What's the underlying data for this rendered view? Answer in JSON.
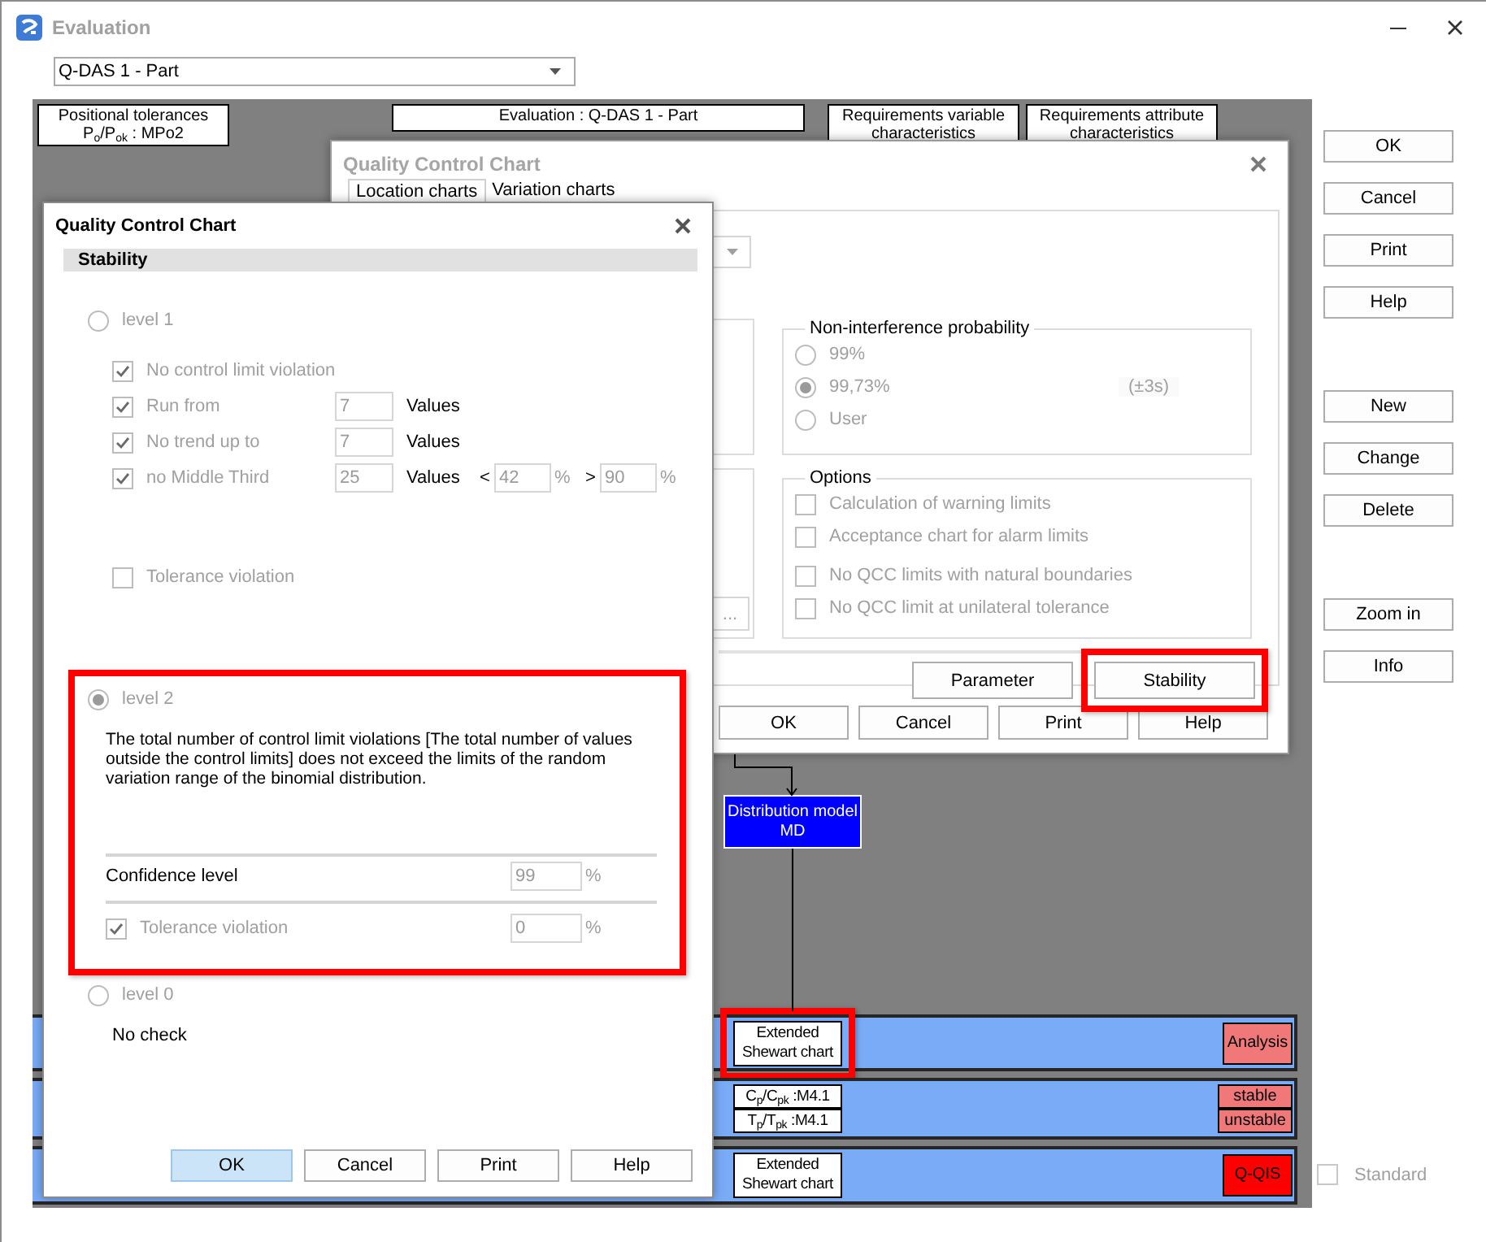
{
  "window": {
    "title": "Evaluation"
  },
  "part_select": {
    "value": "Q-DAS 1 - Part"
  },
  "diagram": {
    "header_boxes": [
      {
        "lines": [
          "Positional tolerances",
          "P$_{o}$/P$_{ok}$ : MPo2"
        ]
      },
      {
        "lines": [
          "Evaluation : Q-DAS 1 - Part"
        ]
      },
      {
        "lines": [
          "Requirements variable",
          "characteristics"
        ]
      },
      {
        "lines": [
          "Requirements attribute",
          "characteristics"
        ]
      }
    ],
    "distribution_model": {
      "lines": [
        "Distribution model",
        "MD"
      ]
    },
    "bands": [
      {
        "nodes": [
          {
            "text": "Extended Shewart chart",
            "highlighted": true
          }
        ],
        "results": [
          {
            "text": "Analysis",
            "color": "#f07878"
          }
        ]
      },
      {
        "nodes": [
          {
            "text": "C$_{p}$/C$_{pk}$ :M4.1",
            "highlighted": false
          },
          {
            "text": "T$_{p}$/T$_{pk}$ :M4.1",
            "highlighted": false
          }
        ],
        "results": [
          {
            "text": "stable",
            "color": "#f07878"
          },
          {
            "text": "unstable",
            "color": "#f07878"
          }
        ]
      },
      {
        "nodes": [
          {
            "text": "Extended Shewart chart",
            "highlighted": false
          }
        ],
        "results": [
          {
            "text": "Q-QIS",
            "color": "#ff0000"
          }
        ]
      }
    ]
  },
  "side_button_groups": [
    [
      "OK",
      "Cancel",
      "Print",
      "Help"
    ],
    [
      "New",
      "Change",
      "Delete"
    ],
    [
      "Zoom in",
      "Info"
    ]
  ],
  "standard": {
    "label": "Standard",
    "checked": false
  },
  "qcc_dialog": {
    "title": "Quality Control Chart",
    "tabs": [
      {
        "label": "Location charts",
        "selected": true
      },
      {
        "label": "Variation charts",
        "selected": false
      }
    ],
    "probability": {
      "title": "Non-interference probability",
      "options": [
        {
          "label": "99%",
          "selected": false
        },
        {
          "label": "99,73%",
          "selected": true,
          "note": "(±3s)"
        },
        {
          "label": "User",
          "selected": false
        }
      ]
    },
    "options": {
      "title": "Options",
      "items": [
        {
          "label": "Calculation of warning limits",
          "checked": false
        },
        {
          "label": "Acceptance chart for alarm limits",
          "checked": false
        },
        {
          "label": "No QCC limits with natural boundaries",
          "checked": false
        },
        {
          "label": "No QCC limit at unilateral tolerance",
          "checked": false
        }
      ]
    },
    "ellipsis_button": "...",
    "panel_buttons": [
      {
        "label": "Parameter",
        "highlighted": false
      },
      {
        "label": "Stability",
        "highlighted": true
      }
    ],
    "buttons": [
      "OK",
      "Cancel",
      "Print",
      "Help"
    ]
  },
  "stability_dialog": {
    "title": "Quality Control Chart",
    "section": "Stability",
    "levels": [
      {
        "kind": "criteria",
        "label": "level 1",
        "selected": false,
        "highlighted": false,
        "criteria": [
          {
            "label": "No control limit violation",
            "checked": true
          },
          {
            "label": "Run from",
            "checked": true,
            "value": "7",
            "unit": "Values"
          },
          {
            "label": "No trend up to",
            "checked": true,
            "value": "7",
            "unit": "Values"
          },
          {
            "label": "no Middle Third",
            "checked": true,
            "value": "25",
            "unit": "Values",
            "bounds": [
              {
                "sign": "<",
                "value": "42",
                "unit": "%"
              },
              {
                "sign": ">",
                "value": "90",
                "unit": "%"
              }
            ]
          }
        ],
        "tolerance": {
          "label": "Tolerance violation",
          "checked": false
        }
      },
      {
        "kind": "binomial",
        "label": "level 2",
        "selected": true,
        "highlighted": true,
        "description": "The total number of control limit violations [The total number of values outside the control limits] does not exceed the limits of the random variation range of the binomial distribution.",
        "confidence": {
          "label": "Confidence level",
          "value": "99",
          "unit": "%"
        },
        "tolerance": {
          "label": "Tolerance violation",
          "checked": true,
          "value": "0",
          "unit": "%"
        }
      },
      {
        "kind": "none",
        "label": "level 0",
        "selected": false,
        "highlighted": false,
        "description": "No check"
      }
    ],
    "buttons": [
      {
        "label": "OK",
        "default": true
      },
      {
        "label": "Cancel",
        "default": false
      },
      {
        "label": "Print",
        "default": false
      },
      {
        "label": "Help",
        "default": false
      }
    ]
  }
}
